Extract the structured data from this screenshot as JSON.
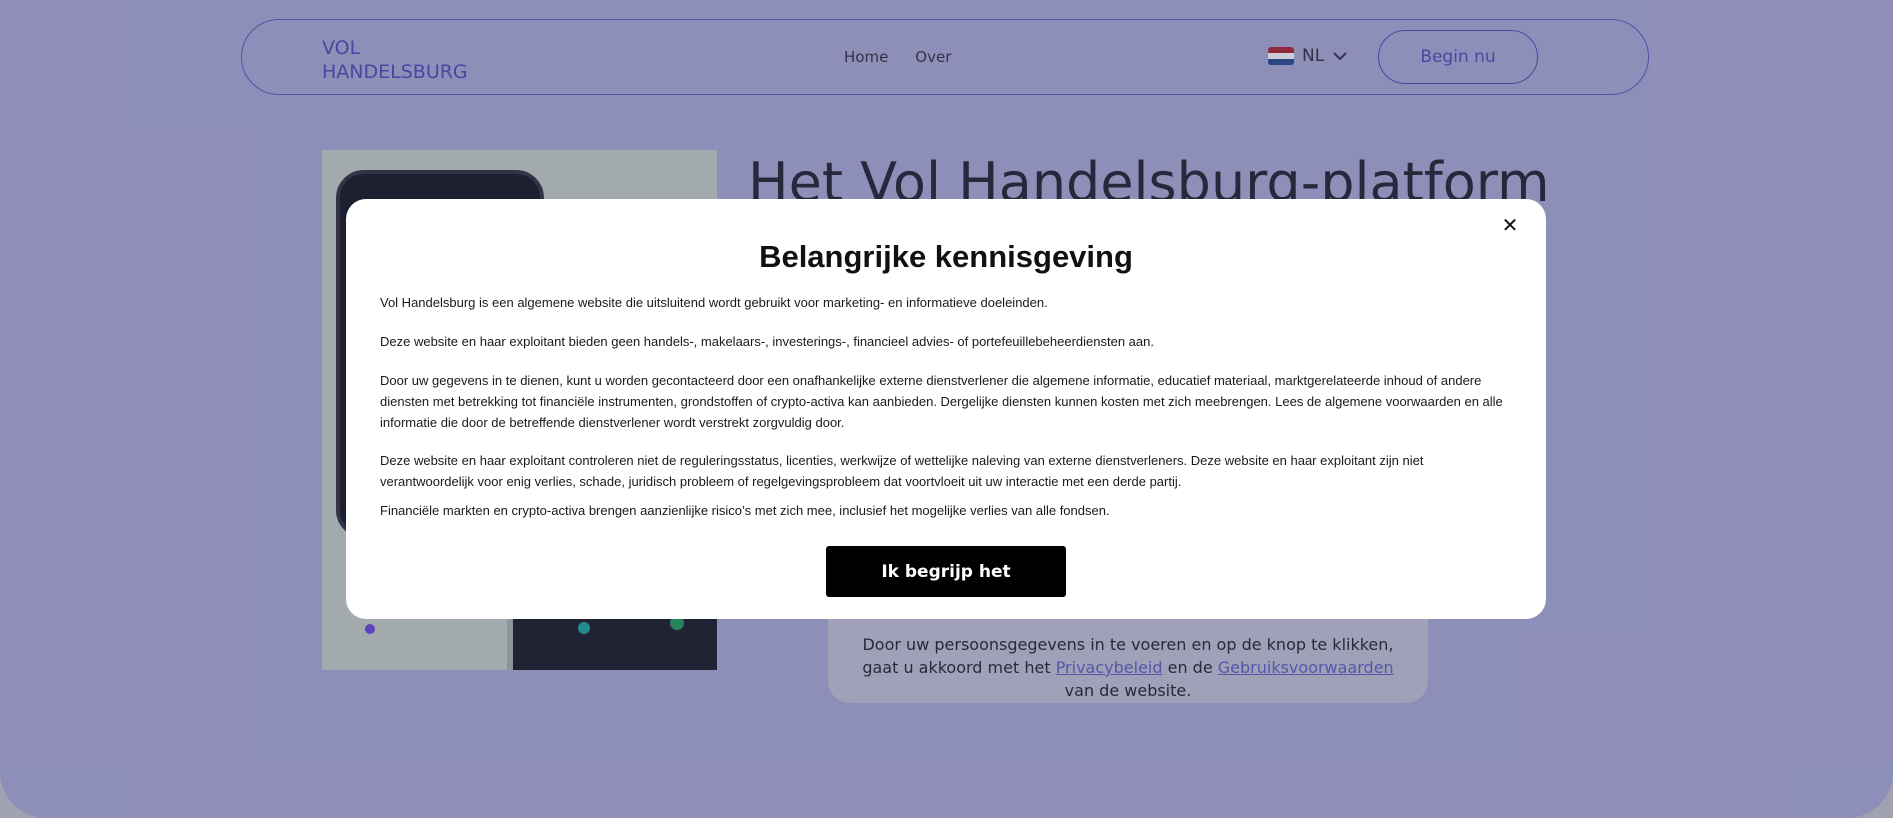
{
  "header": {
    "logo_line1": "VOL",
    "logo_line2": "HANDELSBURG",
    "nav": [
      {
        "label": "Home"
      },
      {
        "label": "Over"
      }
    ],
    "language": {
      "code": "NL",
      "icon": "flag-netherlands-icon",
      "flag_colors": [
        "#ae1c28",
        "#ffffff",
        "#21468b"
      ]
    },
    "cta_label": "Begin nu"
  },
  "hero": {
    "title": "Het Vol Handelsburg-platform"
  },
  "form": {
    "consent_part1": "Door uw persoonsgegevens in te voeren en op de knop te klikken, gaat u akkoord met het ",
    "privacy_link": "Privacybeleid",
    "consent_part2": " en de ",
    "terms_link": "Gebruiksvoorwaarden",
    "consent_part3": " van de website."
  },
  "modal": {
    "close_icon": "close-icon",
    "title": "Belangrijke kennisgeving",
    "paragraphs": [
      "Vol Handelsburg is een algemene website die uitsluitend wordt gebruikt voor marketing- en informatieve doeleinden.",
      "Deze website en haar exploitant bieden geen handels-, makelaars-, investerings-, financieel advies- of portefeuillebeheerdiensten aan.",
      "Door uw gegevens in te dienen, kunt u worden gecontacteerd door een onafhankelijke externe dienstverlener die algemene informatie, educatief materiaal, marktgerelateerde inhoud of andere diensten met betrekking tot financiële instrumenten, grondstoffen of crypto-activa kan aanbieden. Dergelijke diensten kunnen kosten met zich meebrengen. Lees de algemene voorwaarden en alle informatie die door de betreffende dienstverlener wordt verstrekt zorgvuldig door.",
      "Deze website en haar exploitant controleren niet de reguleringsstatus, licenties, werkwijze of wettelijke naleving van externe dienstverleners. Deze website en haar exploitant zijn niet verantwoordelijk voor enig verlies, schade, juridisch probleem of regelgevingsprobleem dat voortvloeit uit uw interactie met een derde partij.",
      "Financiële markten en crypto-activa brengen aanzienlijke risico’s met zich mee, inclusief het mogelijke verlies van alle fondsen."
    ],
    "button_label": "Ik begrijp het"
  },
  "colors": {
    "page_background": "#ababd6",
    "brand": "#4649b5",
    "modal_button": "#000000"
  }
}
